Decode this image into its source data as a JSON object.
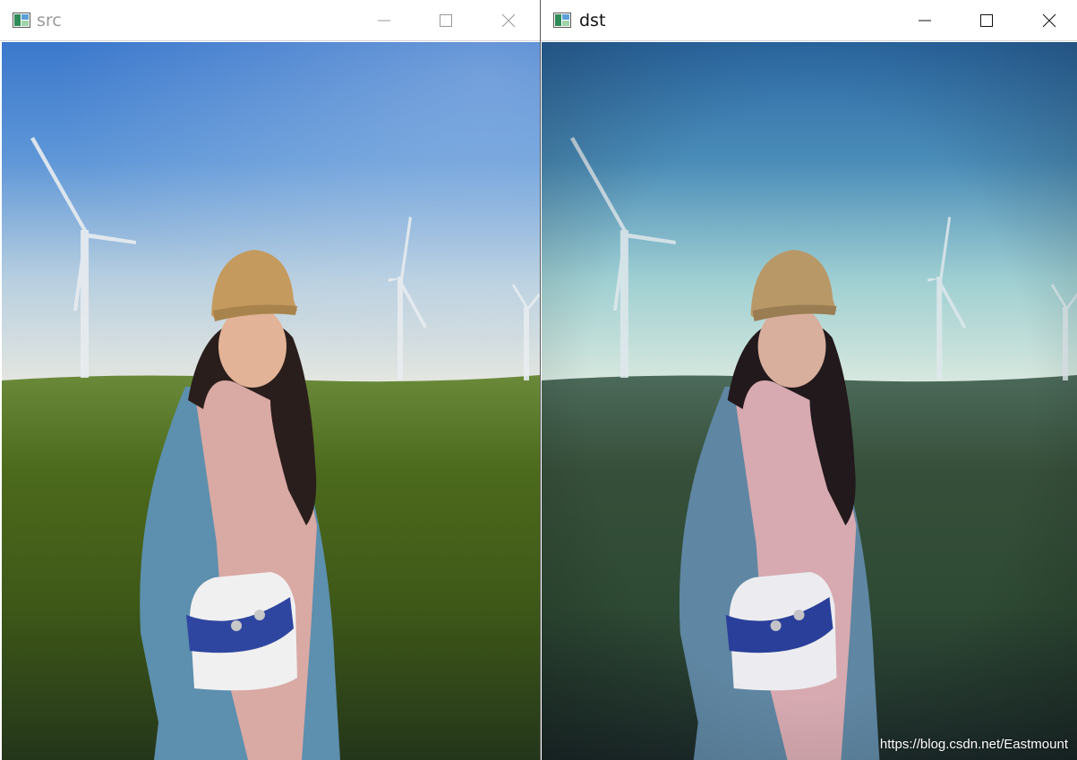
{
  "windows": [
    {
      "id": "src",
      "title": "src",
      "active": false,
      "controls": {
        "minimize": "minimize",
        "maximize": "maximize",
        "close": "close"
      }
    },
    {
      "id": "dst",
      "title": "dst",
      "active": true,
      "controls": {
        "minimize": "minimize",
        "maximize": "maximize",
        "close": "close"
      },
      "watermark": "https://blog.csdn.net/Eastmount"
    }
  ],
  "icons": {
    "app": "opencv-window-icon",
    "minimize": "minimize-icon",
    "maximize": "maximize-icon",
    "close": "close-icon"
  },
  "colors": {
    "src_sky_top": "#3d7fd0",
    "src_sky_bottom": "#dfe7ea",
    "dst_sky_top": "#2f6fa8",
    "dst_sky_bottom": "#c9e3df",
    "src_grass": "#4f6a1f",
    "dst_grass": "#2f4a3c"
  }
}
